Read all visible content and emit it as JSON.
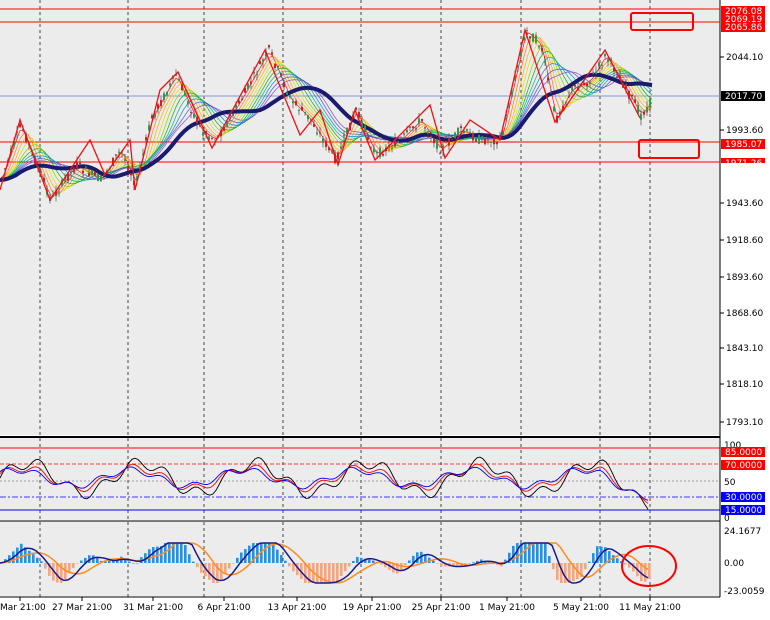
{
  "main_chart": {
    "price_axis": [
      "2044.10",
      "1993.60",
      "1943.60",
      "1918.60",
      "1893.60",
      "1868.60",
      "1843.10",
      "1818.10",
      "1793.10"
    ],
    "price_labels": [
      {
        "text": "2076.08",
        "color": "#ff0000"
      },
      {
        "text": "2069.19",
        "color": "#ff0000"
      },
      {
        "text": "2065.86",
        "color": "#ff0000"
      },
      {
        "text": "2017.70",
        "color": "#000000"
      },
      {
        "text": "1985.07",
        "color": "#ff0000"
      },
      {
        "text": "1971.26",
        "color": "#ff0000"
      },
      {
        "text": "1968.60",
        "color": "#ffffff"
      }
    ]
  },
  "rsi_panel": {
    "axis": [
      "100",
      "50",
      "0"
    ],
    "levels": [
      {
        "text": "85.0000",
        "color": "#ff0000"
      },
      {
        "text": "70.0000",
        "color": "#ff0000"
      },
      {
        "text": "30.0000",
        "color": "#0000ff"
      },
      {
        "text": "15.0000",
        "color": "#0000ff"
      }
    ]
  },
  "macd_panel": {
    "axis": [
      "24.1677",
      "0.00",
      "-23.0059"
    ]
  },
  "time_axis": [
    "Mar 21:00",
    "27 Mar 21:00",
    "31 Mar 21:00",
    "6 Apr 21:00",
    "13 Apr 21:00",
    "19 Apr 21:00",
    "25 Apr 21:00",
    "1 May 21:00",
    "5 May 21:00",
    "11 May 21:00"
  ],
  "colors": {
    "background": "#ececec",
    "red": "#ff0000",
    "navy": "#1a1a6e",
    "blue_hist": "#2a8fe0",
    "orange_hist": "#f4a582"
  }
}
